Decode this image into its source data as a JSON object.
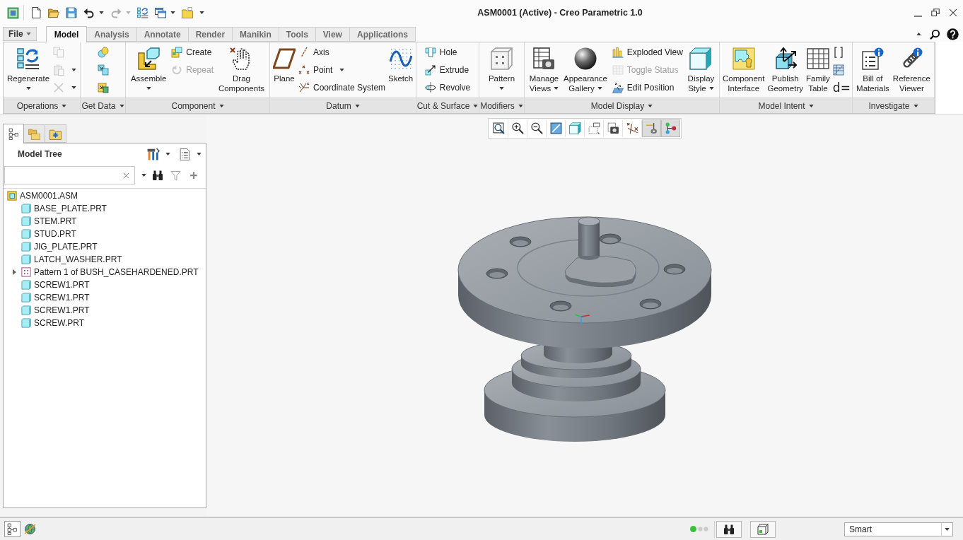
{
  "window": {
    "title": "ASM0001 (Active) - Creo Parametric 1.0"
  },
  "quick_access": [
    {
      "menu": false,
      "disabled": false
    },
    {
      "menu": false,
      "disabled": false
    },
    {
      "menu": false,
      "disabled": false
    },
    {
      "menu": true,
      "disabled": false
    },
    {
      "menu": true,
      "disabled": true
    },
    {
      "menu": false,
      "disabled": false
    },
    {
      "menu": true,
      "disabled": false
    },
    {
      "menu": false,
      "disabled": false
    },
    {
      "menu": true,
      "disabled": false
    }
  ],
  "file_menu": {
    "label": "File"
  },
  "tabs": [
    {
      "label": "Model",
      "selected": true
    },
    {
      "label": "Analysis",
      "selected": false
    },
    {
      "label": "Annotate",
      "selected": false
    },
    {
      "label": "Render",
      "selected": false
    },
    {
      "label": "Manikin",
      "selected": false
    },
    {
      "label": "Tools",
      "selected": false
    },
    {
      "label": "View",
      "selected": false
    },
    {
      "label": "Applications",
      "selected": false
    }
  ],
  "ribbon": {
    "groups": [
      {
        "label": "Operations",
        "tools": [
          {
            "kind": "large",
            "lines": [
              "Regenerate"
            ],
            "menu": true,
            "disabled": false
          },
          {
            "kind": "column",
            "items": [
              {
                "menu": false,
                "disabled": true
              },
              {
                "menu": true,
                "disabled": true
              },
              {
                "menu": true,
                "disabled": true
              }
            ]
          }
        ]
      },
      {
        "label": "Get Data",
        "tools": [
          {
            "kind": "column",
            "items": [
              {
                "menu": false,
                "disabled": false
              },
              {
                "menu": false,
                "disabled": false
              },
              {
                "menu": false,
                "disabled": false
              }
            ]
          }
        ]
      },
      {
        "label": "Component",
        "tools": [
          {
            "kind": "large",
            "lines": [
              "Assemble"
            ],
            "menu": true,
            "disabled": false
          },
          {
            "kind": "column",
            "items": [
              {
                "label": "Create",
                "menu": false,
                "disabled": false
              },
              {
                "label": "Repeat",
                "menu": false,
                "disabled": true
              }
            ]
          },
          {
            "kind": "large",
            "lines": [
              "Drag",
              "Components"
            ],
            "menu": false,
            "disabled": false
          }
        ]
      },
      {
        "label": "Datum",
        "tools": [
          {
            "kind": "large",
            "lines": [
              "Plane"
            ],
            "menu": false,
            "disabled": false
          },
          {
            "kind": "column",
            "items": [
              {
                "label": "Axis",
                "menu": false,
                "disabled": false
              },
              {
                "label": "Point",
                "menu": true,
                "disabled": false
              },
              {
                "label": "Coordinate System",
                "menu": false,
                "disabled": false
              }
            ]
          },
          {
            "kind": "large",
            "lines": [
              "Sketch"
            ],
            "menu": false,
            "disabled": false
          }
        ]
      },
      {
        "label": "Cut & Surface",
        "tools": [
          {
            "kind": "column",
            "items": [
              {
                "label": "Hole",
                "menu": false,
                "disabled": false
              },
              {
                "label": "Extrude",
                "menu": false,
                "disabled": false
              },
              {
                "label": "Revolve",
                "menu": false,
                "disabled": false
              }
            ]
          }
        ]
      },
      {
        "label": "Modifiers",
        "tools": [
          {
            "kind": "large",
            "lines": [
              "Pattern"
            ],
            "menu": true,
            "disabled": false
          }
        ]
      },
      {
        "label": "Model Display",
        "tools": [
          {
            "kind": "large",
            "lines": [
              "Manage",
              "Views"
            ],
            "menu": true,
            "disabled": false
          },
          {
            "kind": "large",
            "lines": [
              "Appearance",
              "Gallery"
            ],
            "menu": true,
            "disabled": false
          },
          {
            "kind": "column",
            "items": [
              {
                "label": "Exploded View",
                "menu": false,
                "disabled": false
              },
              {
                "label": "Toggle Status",
                "menu": false,
                "disabled": true
              },
              {
                "label": "Edit Position",
                "menu": false,
                "disabled": false
              }
            ]
          },
          {
            "kind": "large",
            "lines": [
              "Display",
              "Style"
            ],
            "menu": true,
            "disabled": false
          }
        ]
      },
      {
        "label": "Model Intent",
        "tools": [
          {
            "kind": "large",
            "lines": [
              "Component",
              "Interface"
            ],
            "menu": false,
            "disabled": false
          },
          {
            "kind": "large",
            "lines": [
              "Publish",
              "Geometry"
            ],
            "menu": false,
            "disabled": false
          },
          {
            "kind": "large",
            "lines": [
              "Family",
              "Table"
            ],
            "menu": false,
            "disabled": false
          },
          {
            "kind": "column",
            "items": [
              {
                "menu": false,
                "disabled": false
              },
              {
                "menu": false,
                "disabled": false
              },
              {
                "label": "d=",
                "menu": false,
                "disabled": false
              }
            ]
          }
        ]
      },
      {
        "label": "Investigate",
        "tools": [
          {
            "kind": "large",
            "lines": [
              "Bill of",
              "Materials"
            ],
            "menu": false,
            "disabled": false
          },
          {
            "kind": "large",
            "lines": [
              "Reference",
              "Viewer"
            ],
            "menu": false,
            "disabled": false
          }
        ]
      }
    ]
  },
  "view_toolbar": [
    {
      "on": false
    },
    {
      "on": false
    },
    {
      "on": false
    },
    {
      "on": false
    },
    {
      "on": false
    },
    {
      "on": false
    },
    {
      "on": false
    },
    {
      "on": false
    },
    {
      "on": true
    },
    {
      "on": true
    }
  ],
  "navigator_tabs": [
    {
      "selected": true
    },
    {
      "selected": false
    },
    {
      "selected": false
    }
  ],
  "model_tree": {
    "title": "Model Tree",
    "items": [
      {
        "kind": "assembly",
        "label": "ASM0001.ASM",
        "children": [
          {
            "kind": "part",
            "label": "BASE_PLATE.PRT"
          },
          {
            "kind": "part",
            "label": "STEM.PRT"
          },
          {
            "kind": "part",
            "label": "STUD.PRT"
          },
          {
            "kind": "part",
            "label": "JIG_PLATE.PRT"
          },
          {
            "kind": "part",
            "label": "LATCH_WASHER.PRT"
          },
          {
            "kind": "pattern",
            "label": "Pattern 1 of BUSH_CASEHARDENED.PRT",
            "expanded": false
          },
          {
            "kind": "part",
            "label": "SCREW1.PRT"
          },
          {
            "kind": "part",
            "label": "SCREW1.PRT"
          },
          {
            "kind": "part",
            "label": "SCREW1.PRT"
          },
          {
            "kind": "part",
            "label": "SCREW.PRT"
          }
        ]
      }
    ]
  },
  "status_bar": {
    "toggles": [
      {
        "on": true
      },
      {
        "on": false
      }
    ],
    "filter": {
      "value": "Smart"
    }
  }
}
